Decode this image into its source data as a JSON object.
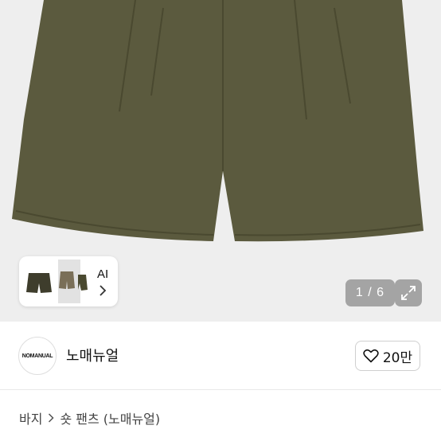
{
  "gallery": {
    "product_color": "#5b5a3e",
    "background_color": "#eeeeee",
    "page_counter": "1 / 6",
    "ai_card": {
      "label": "AI",
      "chevron_icon": "chevron-right-icon"
    },
    "expand_icon": "expand-icon"
  },
  "seller": {
    "avatar_text": "NOMANUAL",
    "name": "노매뉴얼",
    "like_icon": "heart-outline-icon",
    "like_count": "20만"
  },
  "breadcrumb": {
    "items": [
      "바지",
      "숏 팬츠 (노매뉴얼)"
    ],
    "separator_icon": "chevron-right-icon"
  }
}
